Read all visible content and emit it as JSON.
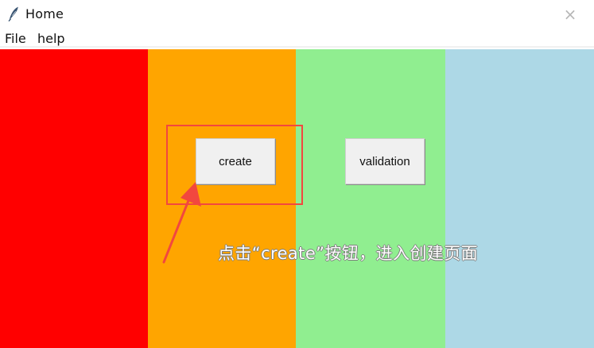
{
  "window": {
    "title": "Home",
    "close_symbol": "×"
  },
  "menu": {
    "items": [
      {
        "label": "File"
      },
      {
        "label": "help"
      }
    ]
  },
  "panels": [
    {
      "color": "#ff0000"
    },
    {
      "color": "#ffa500"
    },
    {
      "color": "#90ee90"
    },
    {
      "color": "#add8e6"
    }
  ],
  "buttons": {
    "create_label": "create",
    "validation_label": "validation"
  },
  "annotation": {
    "text": "点击“create”按钮，进入创建页面",
    "highlight_color": "#f2473f"
  },
  "icons": {
    "app": "feather-icon",
    "close": "close-icon",
    "pointer": "arrow-icon"
  }
}
